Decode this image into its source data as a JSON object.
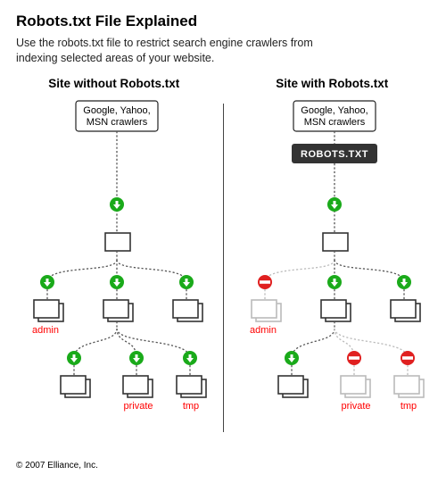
{
  "header": {
    "title": "Robots.txt File Explained",
    "subtitle": "Use the robots.txt file to restrict search engine crawlers from indexing selected areas of your website."
  },
  "left": {
    "title": "Site without Robots.txt",
    "crawler_line1": "Google, Yahoo,",
    "crawler_line2": "MSN crawlers",
    "labels": {
      "admin": "admin",
      "private": "private",
      "tmp": "tmp"
    }
  },
  "right": {
    "title": "Site with Robots.txt",
    "crawler_line1": "Google, Yahoo,",
    "crawler_line2": "MSN crawlers",
    "robots_label": "ROBOTS.TXT",
    "labels": {
      "admin": "admin",
      "private": "private",
      "tmp": "tmp"
    }
  },
  "footer": "© 2007 Elliance, Inc."
}
